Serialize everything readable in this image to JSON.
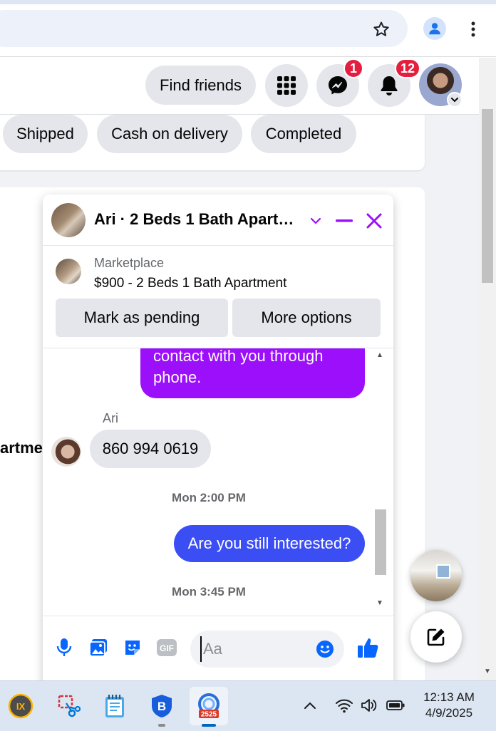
{
  "browser": {
    "star_icon": "star-outline-icon",
    "profile_icon": "person-icon",
    "menu_icon": "kebab-menu-icon"
  },
  "header": {
    "find_friends_label": "Find friends",
    "messenger_badge": "1",
    "notifications_badge": "12",
    "badge_color": "#e41e3f"
  },
  "filters": {
    "chips": [
      "Shipped",
      "Cash on delivery",
      "Completed"
    ]
  },
  "background_listing": {
    "partial_text": "artme"
  },
  "chat": {
    "title": "Ari · 2 Beds 1 Bath Apartm…",
    "marketplace_label": "Marketplace",
    "listing_title": "$900 - 2 Beds 1 Bath Apartment",
    "mark_pending_label": "Mark as pending",
    "more_options_label": "More options",
    "accent_color": "#9c0ffb",
    "messages": {
      "outgoing_top": "contact with you through phone.",
      "sender_name": "Ari",
      "incoming": "860 994 0619",
      "timestamp_1": "Mon 2:00 PM",
      "outgoing_blue": "Are you still interested?",
      "timestamp_2": "Mon 3:45 PM"
    },
    "composer": {
      "placeholder": "Aa",
      "gif_label": "GIF"
    }
  },
  "taskbar": {
    "apps": [
      "ixl-app",
      "snipping-tool",
      "notepad",
      "bitwarden",
      "app-2525"
    ],
    "active_app_badge": "2525",
    "clock_time": "12:13 AM",
    "clock_date": "4/9/2025"
  }
}
